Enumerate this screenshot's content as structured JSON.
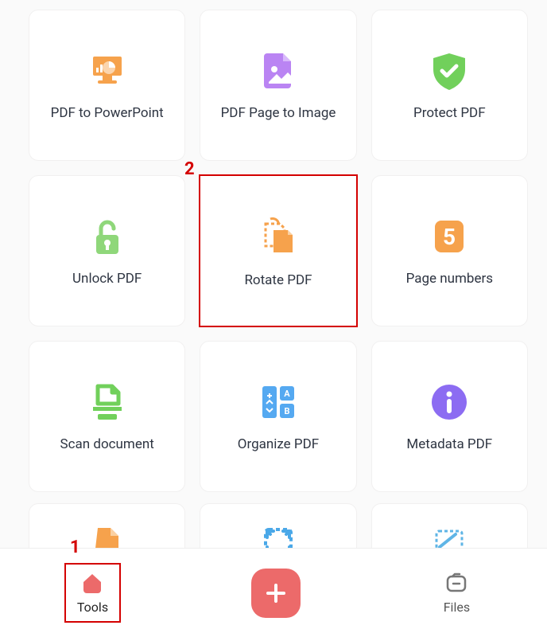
{
  "tools": [
    {
      "id": "pdf-to-powerpoint",
      "label": "PDF to PowerPoint"
    },
    {
      "id": "pdf-page-to-image",
      "label": "PDF Page to Image"
    },
    {
      "id": "protect-pdf",
      "label": "Protect PDF"
    },
    {
      "id": "unlock-pdf",
      "label": "Unlock PDF"
    },
    {
      "id": "rotate-pdf",
      "label": "Rotate PDF"
    },
    {
      "id": "page-numbers",
      "label": "Page numbers"
    },
    {
      "id": "scan-document",
      "label": "Scan document"
    },
    {
      "id": "organize-pdf",
      "label": "Organize PDF"
    },
    {
      "id": "metadata-pdf",
      "label": "Metadata PDF"
    }
  ],
  "bottombar": {
    "tools_label": "Tools",
    "files_label": "Files"
  },
  "annotations": {
    "step1": "1",
    "step2": "2"
  },
  "colors": {
    "orange": "#f6a24c",
    "purple": "#ba84f3",
    "green": "#71d05b",
    "lightgreen": "#8fd77a",
    "blue": "#55a9f1",
    "violet": "#8c6cf2",
    "coral": "#ec6a6a",
    "text": "#2e3542",
    "annot": "#d40000"
  }
}
